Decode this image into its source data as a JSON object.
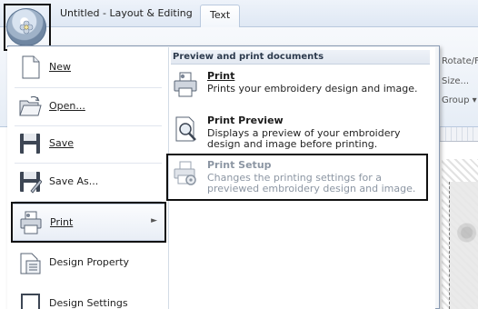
{
  "window": {
    "title_tab": "Untitled - Layout & Editing",
    "ribbon_tab": "Text",
    "ribbon_fragments": [
      "Rotate/Fl",
      "Size...",
      "Group"
    ]
  },
  "app_menu": {
    "left_items": [
      {
        "label": "New",
        "icon": "new-document-icon"
      },
      {
        "label": "Open...",
        "icon": "open-folder-icon"
      },
      {
        "label": "Save",
        "icon": "save-floppy-icon"
      },
      {
        "label": "Save As...",
        "icon": "save-as-floppy-icon"
      },
      {
        "label": "Print",
        "icon": "printer-icon",
        "has_submenu": true
      },
      {
        "label": "Design Property",
        "icon": "design-property-icon"
      },
      {
        "label": "Design Settings",
        "icon": "design-settings-icon"
      }
    ],
    "submenu": {
      "heading": "Preview and print documents",
      "items": [
        {
          "title": "Print",
          "description": "Prints your embroidery design and image.",
          "icon": "printer-icon"
        },
        {
          "title": "Print Preview",
          "description": "Displays a preview of your embroidery design and image before printing.",
          "icon": "print-preview-icon"
        },
        {
          "title": "Print Setup",
          "description": "Changes the printing settings for a previewed embroidery design and image.",
          "icon": "print-setup-icon",
          "disabled": true
        }
      ]
    }
  },
  "colors": {
    "menu_border": "#8a9bb3",
    "submenu_header_bg": "#e2e8f1",
    "disabled_text": "#8c96a3",
    "highlight_frame": "#111111"
  }
}
